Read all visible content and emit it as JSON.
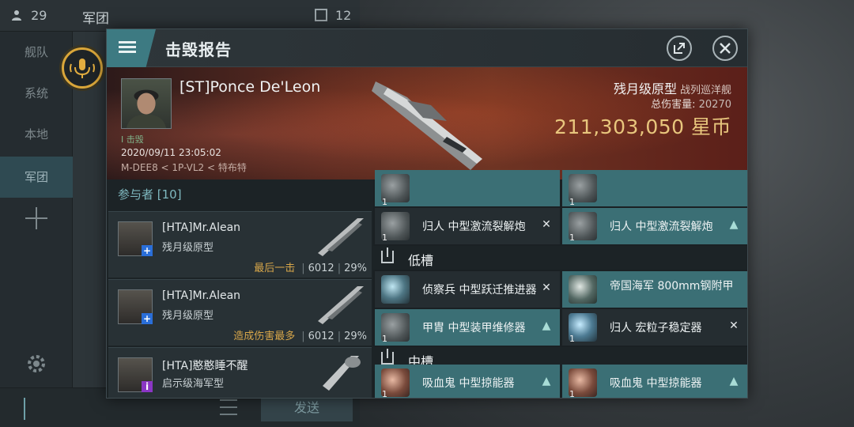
{
  "background": {
    "member_count": "29",
    "channel_title": "军团",
    "right_count": "12",
    "sidebar": [
      {
        "label": "舰队",
        "active": false
      },
      {
        "label": "系统",
        "active": false
      },
      {
        "label": "本地",
        "active": false
      },
      {
        "label": "军团",
        "active": true
      }
    ],
    "send_label": "发送"
  },
  "modal": {
    "title": "击毁报告",
    "icons": {
      "menu": "menu-icon",
      "share": "share-icon",
      "close": "close-icon"
    }
  },
  "hero": {
    "pilot_name": "[ST]Ponce De'Leon",
    "kill_tag": "I 击毁",
    "timestamp": "2020/09/11 23:05:02",
    "location": "M-DEE8 < 1P-VL2 < 特布特",
    "ship_name": "残月级原型",
    "ship_class": "战列巡洋舰",
    "damage_label": "总伤害量:",
    "damage_value": "20270",
    "isk_value": "211,303,050 星币"
  },
  "participants": {
    "header": "参与者 [10]",
    "list": [
      {
        "name": "[HTA]Mr.Alean",
        "ship": "残月级原型",
        "tag": "最后一击",
        "damage": "6012",
        "percent": "29%",
        "badge": "+",
        "badge_color": "#2a6ed8"
      },
      {
        "name": "[HTA]Mr.Alean",
        "ship": "残月级原型",
        "tag": "造成伤害最多",
        "damage": "6012",
        "percent": "29%",
        "badge": "+",
        "badge_color": "#2a6ed8"
      },
      {
        "name": "[HTA]憨憨睡不醒",
        "ship": "启示级海军型",
        "tag": "",
        "damage": "",
        "percent": "",
        "badge": "i",
        "badge_color": "#8a36c4"
      }
    ]
  },
  "modules": {
    "top_rows": [
      {
        "left": {
          "qty": "1",
          "name": "归人 中型激流裂解炮",
          "state": "x"
        },
        "right": {
          "qty": "1",
          "name": "归人 中型激流裂解炮",
          "state": "person"
        }
      }
    ],
    "low_slot_title": "低槽",
    "low_rows": [
      {
        "left": {
          "qty": "",
          "name": "侦察兵 中型跃迁推进器",
          "state": "x"
        },
        "right": {
          "qty": "",
          "name": "帝国海军 800mm钢附甲",
          "state": "none"
        }
      },
      {
        "left": {
          "qty": "1",
          "name": "甲胄 中型装甲维修器",
          "state": "person"
        },
        "right": {
          "qty": "1",
          "name": "归人 宏粒子稳定器",
          "state": "x"
        }
      }
    ],
    "mid_slot_title": "中槽",
    "mid_rows": [
      {
        "left": {
          "qty": "1",
          "name": "吸血鬼 中型掠能器",
          "state": "person"
        },
        "right": {
          "qty": "1",
          "name": "吸血鬼 中型掠能器",
          "state": "person"
        }
      }
    ]
  },
  "colors": {
    "accent_teal": "#3d7a82",
    "module_teal": "#3b6f75",
    "isk_gold": "#e8c67d",
    "tag_gold": "#d7a64a",
    "mic_ring": "#d9a63a"
  }
}
